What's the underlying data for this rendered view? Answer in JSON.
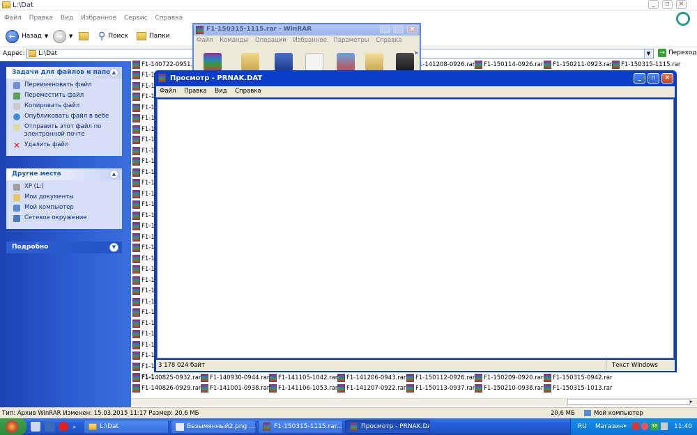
{
  "explorer": {
    "title": "L:\\Dat",
    "menu": [
      "Файл",
      "Правка",
      "Вид",
      "Избранное",
      "Сервис",
      "Справка"
    ],
    "toolbar": {
      "back": "Назад",
      "search": "Поиск",
      "folders": "Папки"
    },
    "address_label": "Адрес:",
    "address_value": "L:\\Dat",
    "go_label": "Переход",
    "status_left": "Тип: Архив WinRAR Изменен: 15.03.2015 11:17 Размер: 20,6 МБ",
    "status_size": "20,6 МБ",
    "status_location": "Мой компьютер"
  },
  "sidebar": {
    "tasks": {
      "title": "Задачи для файлов и папок",
      "items": [
        "Переименовать файл",
        "Переместить файл",
        "Копировать файл",
        "Опубликовать файл в вебе",
        "Отправить этот файл по электронной почте",
        "Удалить файл"
      ]
    },
    "places": {
      "title": "Другие места",
      "items": [
        "XP (L:)",
        "Мои документы",
        "Мой компьютер",
        "Сетевое окружение"
      ]
    },
    "details": {
      "title": "Подробно"
    }
  },
  "files": {
    "truncated_prefix": "F1-1",
    "top_row": [
      "F1-140722-0951.rar",
      "F1-141208-0926.rar",
      "F1-150114-0926.rar",
      "F1-150211-0923.rar",
      "F1-150315-1115.rar"
    ],
    "bottom_row1": [
      "F1-140825-0932.rar",
      "F1-140930-0944.rar",
      "F1-141105-1042.rar",
      "F1-141206-0943.rar",
      "F1-150112-0926.rar",
      "F1-150209-0920.rar",
      "F1-150315-0942.rar"
    ],
    "bottom_row2": [
      "F1-140826-0929.rar",
      "F1-141001-0938.rar",
      "F1-141106-1053.rar",
      "F1-141207-0922.rar",
      "F1-150113-0937.rar",
      "F1-150210-0938.rar",
      "F1-150315-1013.rar"
    ]
  },
  "winrar": {
    "title": "F1-150315-1115.rar - WinRAR",
    "menu": [
      "Файл",
      "Команды",
      "Операции",
      "Избранное",
      "Параметры",
      "Справка"
    ]
  },
  "viewer": {
    "title": "Просмотр - PRNAK.DAT",
    "menu": [
      "Файл",
      "Правка",
      "Вид",
      "Справка"
    ],
    "status_size": "3 178 024 байт",
    "status_mode": "Текст Windows"
  },
  "taskbar": {
    "buttons": [
      "L:\\Dat",
      "Безымянный2.png ...",
      "F1-150315-1115.rar...",
      "Просмотр - PRNAK.DAT"
    ],
    "language": "RU",
    "shop": "Магазин",
    "time": "11:40"
  },
  "colors": {
    "xp_blue": "#0a3ec8",
    "sidebar_blue": "#2a5ed2",
    "panel": "#d6dff7"
  }
}
